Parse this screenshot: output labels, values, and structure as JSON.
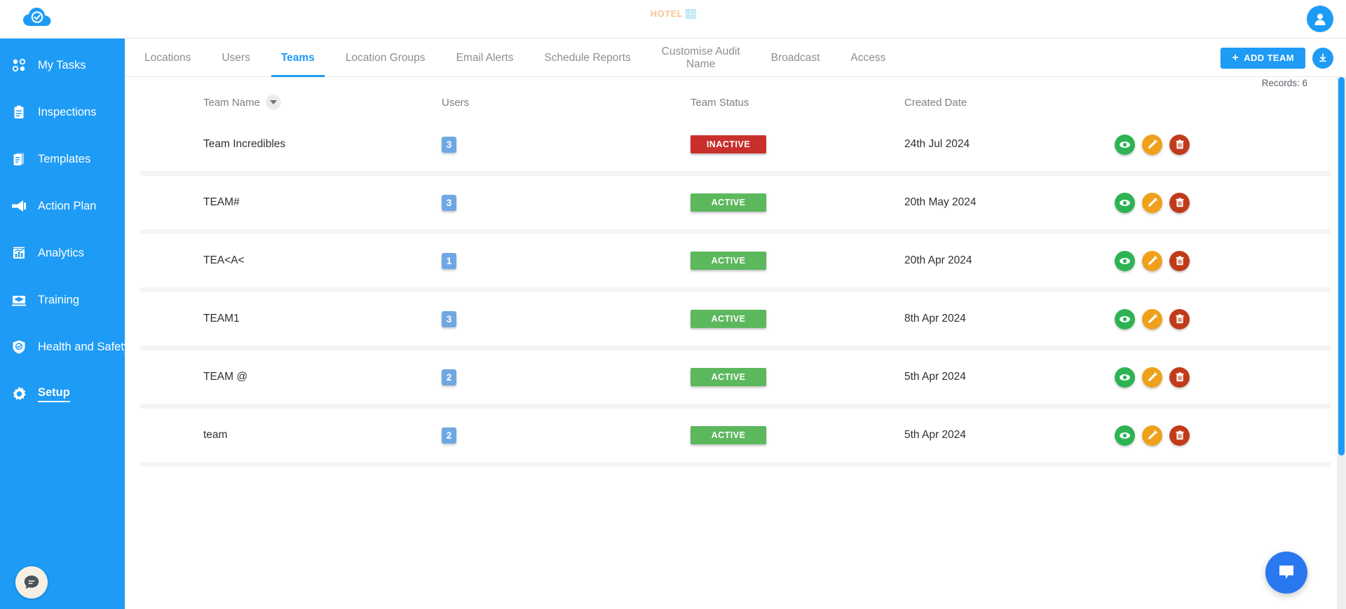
{
  "topbar": {
    "brand_icon": "cloud-check-logo",
    "center_logo_text": "HOTEL",
    "center_logo_mark": "grid-icon",
    "avatar_icon": "user-avatar-icon"
  },
  "sidebar": {
    "items": [
      {
        "label": "My Tasks",
        "icon": "dots-grid-icon",
        "active": false
      },
      {
        "label": "Inspections",
        "icon": "clipboard-icon",
        "active": false
      },
      {
        "label": "Templates",
        "icon": "documents-icon",
        "active": false
      },
      {
        "label": "Action Plan",
        "icon": "megaphone-icon",
        "active": false
      },
      {
        "label": "Analytics",
        "icon": "bar-chart-icon",
        "active": false
      },
      {
        "label": "Training",
        "icon": "graduation-icon",
        "active": false
      },
      {
        "label": "Health and Safety",
        "icon": "shield-check-icon",
        "active": false
      },
      {
        "label": "Setup",
        "icon": "gear-icon",
        "active": true
      }
    ],
    "chat_icon": "speech-bubble-icon"
  },
  "tabs": [
    {
      "label": "Locations",
      "active": false
    },
    {
      "label": "Users",
      "active": false
    },
    {
      "label": "Teams",
      "active": true
    },
    {
      "label": "Location Groups",
      "active": false
    },
    {
      "label": "Email Alerts",
      "active": false
    },
    {
      "label": "Schedule Reports",
      "active": false
    },
    {
      "label": "Customise Audit\nName",
      "active": false
    },
    {
      "label": "Broadcast",
      "active": false
    },
    {
      "label": "Access",
      "active": false
    }
  ],
  "toolbar": {
    "add_team_label": "ADD TEAM",
    "add_plus": "+",
    "download_icon": "download-circle-icon",
    "records_label": "Records: 6"
  },
  "table": {
    "columns": [
      "Team Name",
      "Users",
      "Team Status",
      "Created Date"
    ],
    "sort_icon": "chevron-down-icon",
    "rows": [
      {
        "name": "Team Incredibles",
        "users": "3",
        "status": "INACTIVE",
        "status_state": "inactive",
        "created": "24th Jul 2024"
      },
      {
        "name": "TEAM#",
        "users": "3",
        "status": "ACTIVE",
        "status_state": "active",
        "created": "20th May 2024"
      },
      {
        "name": "TEA<A<",
        "users": "1",
        "status": "ACTIVE",
        "status_state": "active",
        "created": "20th Apr 2024"
      },
      {
        "name": "TEAM1",
        "users": "3",
        "status": "ACTIVE",
        "status_state": "active",
        "created": "8th Apr 2024"
      },
      {
        "name": "TEAM @",
        "users": "2",
        "status": "ACTIVE",
        "status_state": "active",
        "created": "5th Apr 2024"
      },
      {
        "name": "team",
        "users": "2",
        "status": "ACTIVE",
        "status_state": "active",
        "created": "5th Apr 2024"
      }
    ],
    "row_actions": [
      {
        "name": "view-button",
        "icon": "eye-icon"
      },
      {
        "name": "edit-button",
        "icon": "pencil-icon"
      },
      {
        "name": "delete-button",
        "icon": "trash-icon"
      }
    ]
  },
  "chat_widget": {
    "icon": "speech-bubble-icon"
  },
  "colors": {
    "brand_blue": "#1e9bf5",
    "active_green": "#5cb85c",
    "inactive_red": "#c9302c",
    "users_badge_blue": "#6ea8e3",
    "view_green": "#2eb354",
    "edit_orange": "#efa11c",
    "delete_red": "#c13b1b",
    "chat_blue": "#2a78f0"
  }
}
